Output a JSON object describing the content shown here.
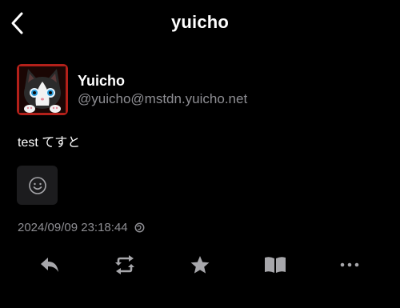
{
  "header": {
    "title": "yuicho",
    "back_icon": "chevron-left-icon"
  },
  "author": {
    "display_name": "Yuicho",
    "acct": "@yuicho@mstdn.yuicho.net",
    "avatar": "black-white-cat-avatar"
  },
  "status": {
    "content": "test てすと",
    "timestamp": "2024/09/09 23:18:44",
    "visibility_icon": "globe-icon",
    "reaction_icon": "smiley-face-icon"
  },
  "actions": [
    {
      "name": "reply",
      "icon": "reply-icon"
    },
    {
      "name": "boost",
      "icon": "boost-icon"
    },
    {
      "name": "favourite",
      "icon": "star-icon"
    },
    {
      "name": "bookmark",
      "icon": "book-icon"
    },
    {
      "name": "more",
      "icon": "more-icon"
    }
  ],
  "colors": {
    "background": "#000000",
    "text": "#ffffff",
    "secondary": "#8e8e93",
    "icon": "#a7a7ab",
    "reaction_bg": "#1c1c1e"
  }
}
